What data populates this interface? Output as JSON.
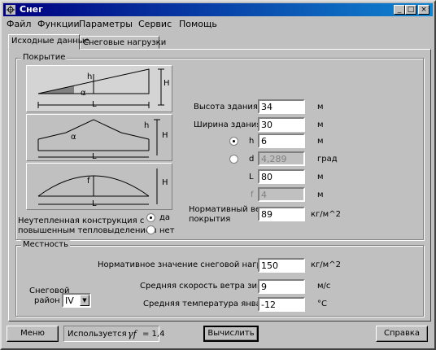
{
  "window": {
    "title": "Снег"
  },
  "menu": [
    "Файл",
    "Функции",
    "Параметры",
    "Сервис",
    "Помощь"
  ],
  "tabs": [
    "Исходные данные",
    "Снеговые нагрузки"
  ],
  "pokrytie": {
    "group_label": "Покрытие",
    "diag1": {
      "h": "h",
      "H": "H",
      "L": "L",
      "alpha": "α"
    },
    "diag2": {
      "h": "h",
      "H": "H",
      "L": "L",
      "alpha": "α"
    },
    "diag3": {
      "f": "f",
      "H": "H",
      "L": "L"
    },
    "unheated_label_line1": "Неутепленная конструкция с",
    "unheated_label_line2": "повышенным тепловыделением",
    "radio_yes": "да",
    "radio_no": "нет",
    "height_label": "Высота здания",
    "height_value": "34",
    "height_unit": "м",
    "width_label": "Ширина здания",
    "width_value": "30",
    "width_unit": "м",
    "h_label": "h",
    "h_value": "6",
    "h_unit": "м",
    "d_label": "d",
    "d_value": "4,289",
    "d_unit": "град",
    "L_label": "L",
    "L_value": "80",
    "L_unit": "м",
    "f_label": "f",
    "f_value": "4",
    "f_unit": "м",
    "norm_weight_line1": "Нормативный вес",
    "norm_weight_line2": "покрытия",
    "norm_weight_value": "89",
    "norm_weight_unit": "кг/м^2"
  },
  "mestnost": {
    "group_label": "Местность",
    "snow_norm_label": "Нормативное значение снеговой нагрузки",
    "snow_norm_value": "150",
    "snow_norm_unit": "кг/м^2",
    "region_line1": "Снеговой",
    "region_line2": "район",
    "region_value": "IV",
    "wind_label": "Средняя скорость ветра зимой",
    "wind_value": "9",
    "wind_unit": "м/с",
    "temp_label": "Средняя температура января",
    "temp_value": "-12",
    "temp_unit": "°С"
  },
  "bottom": {
    "menu_button": "Меню",
    "status_prefix": "Используется",
    "status_gamma": "γf",
    "status_value": "= 1,4",
    "calc_button": "Вычислить",
    "help_button": "Справка"
  }
}
